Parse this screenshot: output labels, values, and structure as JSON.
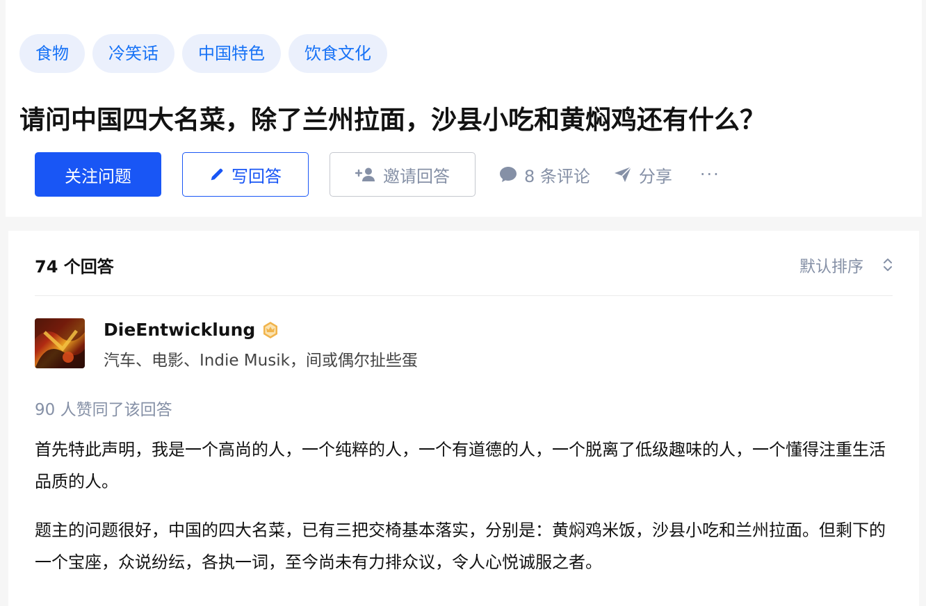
{
  "question": {
    "topics": [
      "食物",
      "冷笑话",
      "中国特色",
      "饮食文化"
    ],
    "title": "请问中国四大名菜，除了兰州拉面，沙县小吃和黄焖鸡还有什么？",
    "actions": {
      "follow_label": "关注问题",
      "write_label": "写回答",
      "invite_label": "邀请回答",
      "comments_label": "8 条评论",
      "share_label": "分享",
      "more_label": "···"
    }
  },
  "answers": {
    "count_label": "74 个回答",
    "sort_label": "默认排序",
    "first": {
      "author_name": "DieEntwicklung",
      "author_bio": "汽车、电影、Indie Musik，间或偶尔扯些蛋",
      "votes_label": "90 人赞同了该回答",
      "paragraphs": [
        "首先特此声明，我是一个高尚的人，一个纯粹的人，一个有道德的人，一个脱离了低级趣味的人，一个懂得注重生活品质的人。",
        "题主的问题很好，中国的四大名菜，已有三把交椅基本落实，分别是：黄焖鸡米饭，沙县小吃和兰州拉面。但剩下的一个宝座，众说纷纭，各执一词，至今尚未有力排众议，令人心悦诚服之者。"
      ]
    }
  },
  "colors": {
    "accent": "#1956f5",
    "topic_bg": "#ebf0fc",
    "topic_text": "#1772f6",
    "muted": "#8590a6",
    "badge": "#f1b44c"
  }
}
